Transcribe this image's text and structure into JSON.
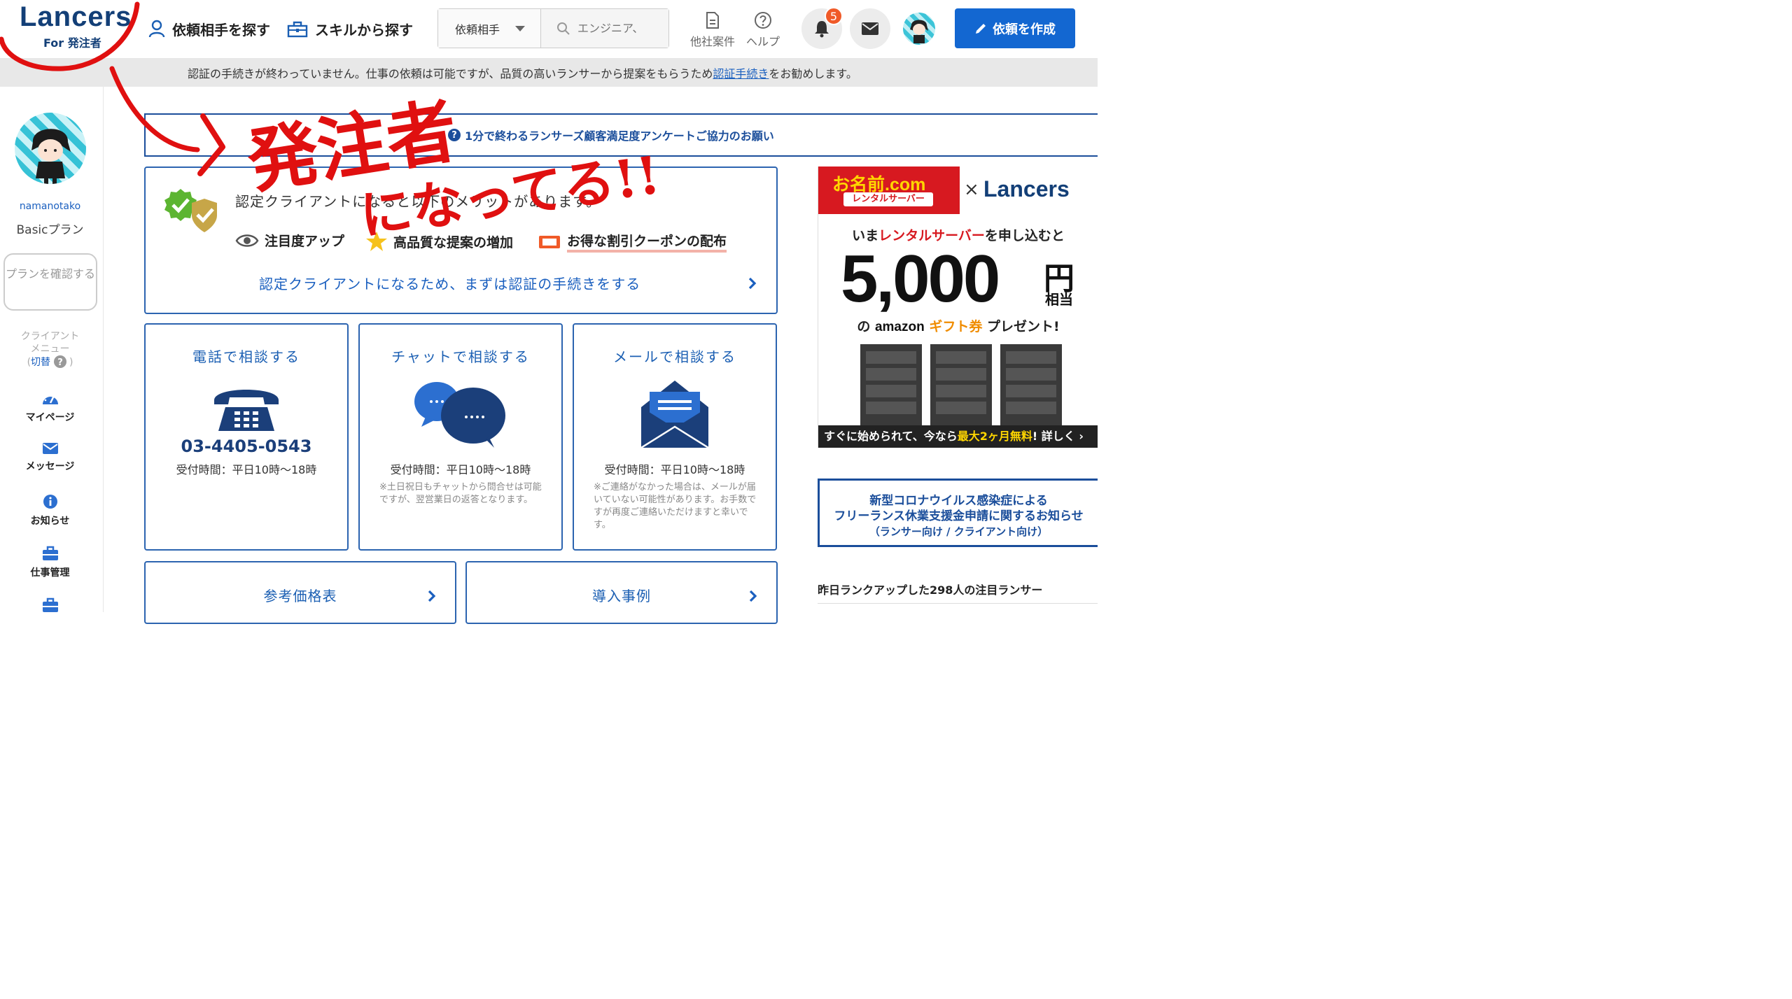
{
  "header": {
    "logo_main": "Lancers",
    "logo_sub": "For 発注者",
    "nav_find_partner": "依頼相手を探す",
    "nav_find_skill": "スキルから探す",
    "search_select": "依頼相手",
    "search_placeholder": "エンジニア、",
    "other_jobs": "他社案件",
    "help": "ヘルプ",
    "notification_count": "5",
    "create_button": "依頼を作成"
  },
  "notice": {
    "text_before": "認証の手続きが終わっていません。仕事の依頼は可能ですが、品質の高いランサーから提案をもらうため",
    "link": "認証手続き",
    "text_after": "をお勧めします。"
  },
  "sidebar": {
    "username": "namanotako",
    "plan": "Basicプラン",
    "plan_button": "プランを確認する",
    "client_menu_line1": "クライアント",
    "client_menu_line2": "メニュー",
    "client_menu_switch": "切替",
    "items": [
      {
        "label": "マイページ",
        "icon": "dashboard-icon"
      },
      {
        "label": "メッセージ",
        "icon": "envelope-icon"
      },
      {
        "label": "お知らせ",
        "icon": "info-icon"
      },
      {
        "label": "仕事管理",
        "icon": "briefcase-icon"
      }
    ]
  },
  "survey": {
    "text": "1分で終わるランサーズ顧客満足度アンケートご協力のお願い"
  },
  "cert": {
    "intro": "認定クライアントになると以下のメリットがあります。",
    "benefits": [
      "注目度アップ",
      "高品質な提案の増加",
      "お得な割引クーポンの配布"
    ],
    "link": "認定クライアントになるため、まずは認証の手続きをする"
  },
  "contacts": [
    {
      "title": "電話で相談する",
      "phone": "03-4405-0543",
      "hours": "受付時間：平日10時〜18時",
      "note": ""
    },
    {
      "title": "チャットで相談する",
      "hours": "受付時間：平日10時〜18時",
      "note": "※土日祝日もチャットから問合せは可能ですが、翌営業日の返答となります。"
    },
    {
      "title": "メールで相談する",
      "hours": "受付時間：平日10時〜18時",
      "note": "※ご連絡がなかった場合は、メールが届いていない可能性があります。お手数ですが再度ご連絡いただけますと幸いです。"
    }
  ],
  "bottom": {
    "price_table": "参考価格表",
    "case_studies": "導入事例"
  },
  "ad": {
    "brand": "お名前.com",
    "rental": "レンタルサーバー",
    "x": "×",
    "partner": "Lancers",
    "line1_pre": "いま",
    "line1_em": "レンタルサーバー",
    "line1_post": "を申し込むと",
    "amount": "5,000",
    "yen": "円",
    "equiv": "相当",
    "amazon_pre": "の",
    "amazon": "amazon",
    "gift": "ギフト券",
    "amazon_post": "プレゼント!",
    "bottom_pre": "すぐに始められて、今なら",
    "bottom_em": "最大2ヶ月無料",
    "bottom_post": "! 詳しく ›"
  },
  "covid": {
    "line1": "新型コロナウイルス感染症による",
    "line2": "フリーランス休業支援金申請に関するお知らせ",
    "line3": "（ランサー向け / クライアント向け）"
  },
  "rankup": "昨日ランクアップした298人の注目ランサー",
  "annotation": {
    "line1": "発注者",
    "line2": "になってる!!"
  },
  "colors": {
    "brand_navy": "#133f77",
    "primary_blue": "#1367d1",
    "annotation_red": "#e01010"
  }
}
